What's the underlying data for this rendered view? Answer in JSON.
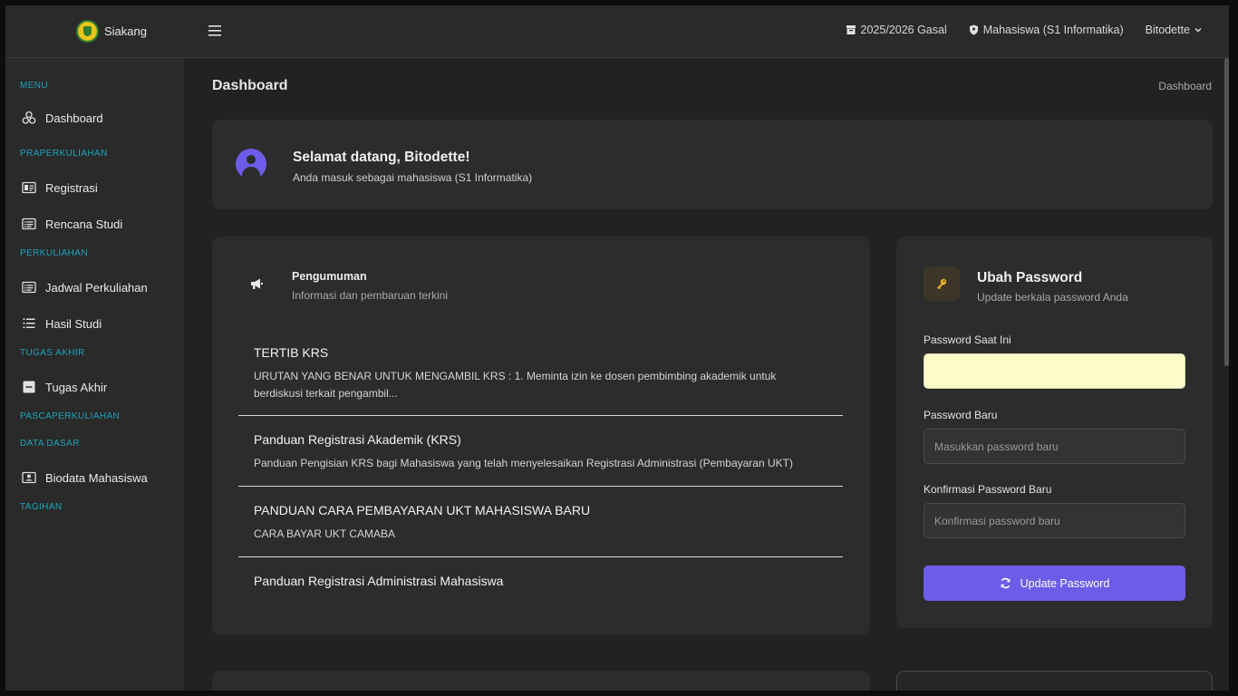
{
  "app": {
    "name": "Siakang"
  },
  "topbar": {
    "semester": "2025/2026 Gasal",
    "role": "Mahasiswa (S1 Informatika)",
    "user": "Bitodette"
  },
  "sidebar": {
    "sections": {
      "menu": "MENU",
      "praperkuliahan": "PRAPERKULIAHAN",
      "perkuliahan": "PERKULIAHAN",
      "tugas_akhir": "TUGAS AKHIR",
      "pascaperkuliahan": "PASCAPERKULIAHAN",
      "data_dasar": "DATA DASAR",
      "tagihan": "TAGIHAN"
    },
    "items": {
      "dashboard": "Dashboard",
      "registrasi": "Registrasi",
      "rencana_studi": "Rencana Studi",
      "jadwal_perkuliahan": "Jadwal Perkuliahan",
      "hasil_studi": "Hasil Studi",
      "tugas_akhir": "Tugas Akhir",
      "biodata_mahasiswa": "Biodata Mahasiswa"
    }
  },
  "page": {
    "title": "Dashboard",
    "breadcrumb": "Dashboard"
  },
  "welcome": {
    "title": "Selamat datang, Bitodette!",
    "subtitle": "Anda masuk sebagai mahasiswa (S1 Informatika)"
  },
  "announcements": {
    "title": "Pengumuman",
    "subtitle": "Informasi dan pembaruan terkini",
    "items": [
      {
        "title": "TERTIB KRS",
        "desc": "URUTAN YANG BENAR UNTUK MENGAMBIL KRS : 1. Meminta izin ke dosen pembimbing akademik untuk berdiskusi terkait pengambil..."
      },
      {
        "title": "Panduan Registrasi Akademik (KRS)",
        "desc": "Panduan Pengisian KRS bagi Mahasiswa yang telah menyelesaikan Registrasi Administrasi (Pembayaran UKT)"
      },
      {
        "title": "PANDUAN CARA PEMBAYARAN UKT MAHASISWA BARU",
        "desc": "CARA BAYAR UKT CAMABA"
      },
      {
        "title": "Panduan Registrasi Administrasi Mahasiswa",
        "desc": ""
      }
    ]
  },
  "password": {
    "title": "Ubah Password",
    "subtitle": "Update berkala password Anda",
    "current_label": "Password Saat Ini",
    "current_value": "",
    "new_label": "Password Baru",
    "new_placeholder": "Masukkan password baru",
    "confirm_label": "Konfirmasi Password Baru",
    "confirm_placeholder": "Konfirmasi password baru",
    "button": "Update Password"
  },
  "colors": {
    "accent": "#6c5ce7",
    "section_label": "#1fa3bc",
    "autofill": "#fdfcc9",
    "key_icon": "#f0b429"
  },
  "icons": {
    "logo": "university-logo",
    "menu": "hamburger-icon",
    "semester": "calendar-archive-icon",
    "role": "shield-icon",
    "user_caret": "chevron-down-icon",
    "announcement": "megaphone-icon",
    "password": "key-icon",
    "update": "refresh-icon"
  }
}
